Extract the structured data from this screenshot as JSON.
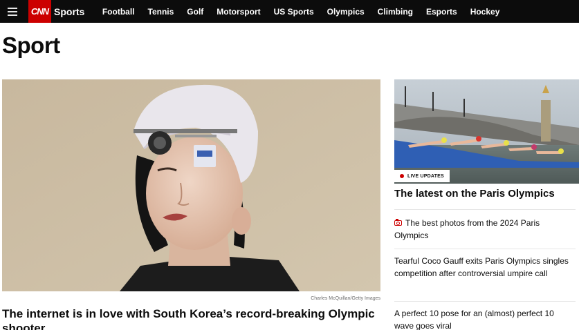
{
  "nav": {
    "logo": "CNN",
    "section": "Sports",
    "items": [
      "Football",
      "Tennis",
      "Golf",
      "Motorsport",
      "US Sports",
      "Olympics",
      "Climbing",
      "Esports",
      "Hockey"
    ]
  },
  "page": {
    "title": "Sport"
  },
  "hero": {
    "credit": "Charles McQuillan/Getty Images",
    "headline": "The internet is in love with South Korea’s record-breaking Olympic shooter"
  },
  "side": {
    "badge": "LIVE UPDATES",
    "headline": "The latest on the Paris Olympics",
    "items": [
      {
        "icon": "camera-icon",
        "text": "The best photos from the 2024 Paris Olympics"
      },
      {
        "text": "Tearful Coco Gauff exits Paris Olympics singles competition after controversial umpire call"
      },
      {
        "text": "A perfect 10 pose for an (almost) perfect 10 wave goes viral"
      }
    ]
  },
  "colors": {
    "brand_red": "#cc0000",
    "nav_bg": "#0c0c0c"
  }
}
